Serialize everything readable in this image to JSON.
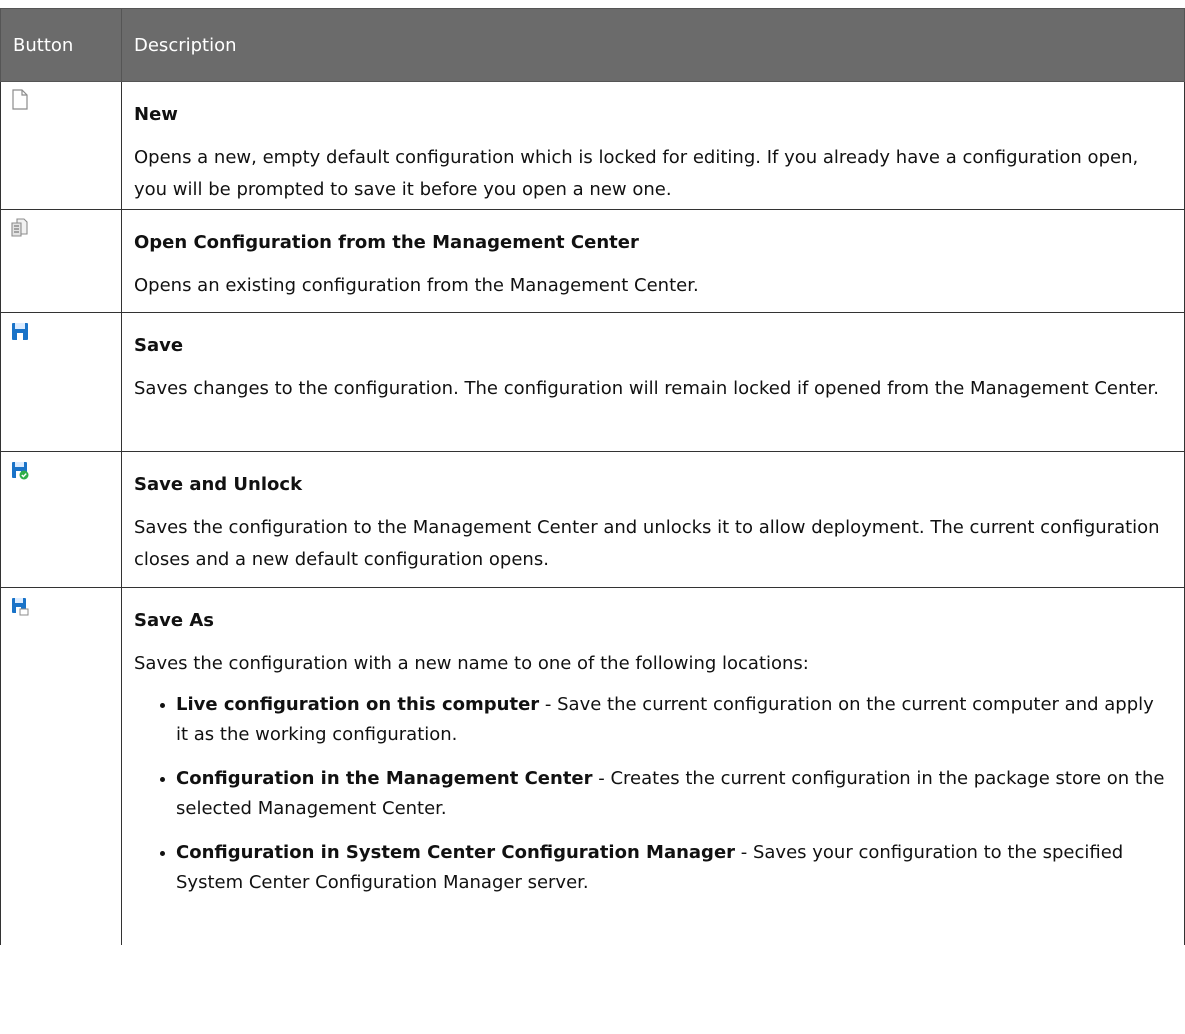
{
  "header": {
    "col_button": "Button",
    "col_description": "Description"
  },
  "rows": [
    {
      "icon": "new-document-icon",
      "title": "New",
      "description": "Opens a new, empty default configuration which is locked for editing. If you already have a configuration open, you will be prompted to save it before you open a new one."
    },
    {
      "icon": "open-configuration-icon",
      "title": "Open Configuration from the Management Center",
      "description": "Opens an existing configuration from the Management Center."
    },
    {
      "icon": "save-icon",
      "title": "Save",
      "description": "Saves changes to the configuration. The configuration will remain locked if opened from the Management Center."
    },
    {
      "icon": "save-and-unlock-icon",
      "title": "Save and Unlock",
      "description": "Saves the configuration to the Management Center and unlocks it to allow deployment. The current configuration closes and a new default configuration opens."
    },
    {
      "icon": "save-as-icon",
      "title": "Save As",
      "description": "Saves the configuration with a new name to one of the following locations:",
      "bullets": [
        {
          "label": "Live configuration on this computer",
          "text": " - Save the current configuration on the current computer and apply it as the working configuration."
        },
        {
          "label": "Configuration in the Management Center",
          "text": " - Creates the current configuration in the package store on the selected Management Center."
        },
        {
          "label": "Configuration in System Center Configuration Manager",
          "text": " - Saves your configuration to the specified System Center Configuration Manager server."
        }
      ]
    }
  ],
  "colors": {
    "header_bg": "#6b6b6b",
    "icon_blue": "#1a73c8",
    "icon_green": "#2fae4a",
    "icon_gray": "#9a9a9a"
  }
}
